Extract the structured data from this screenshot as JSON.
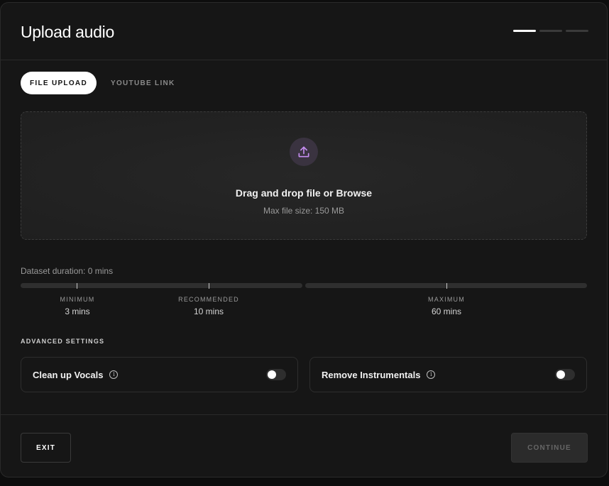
{
  "modal": {
    "title": "Upload audio",
    "steps": {
      "total": 3,
      "current": 1
    }
  },
  "tabs": [
    {
      "label": "FILE UPLOAD",
      "active": true
    },
    {
      "label": "YOUTUBE LINK",
      "active": false
    }
  ],
  "dropzone": {
    "icon": "upload-icon",
    "title": "Drag and drop file or Browse",
    "subtitle": "Max file size: 150 MB"
  },
  "duration": {
    "label": "Dataset duration: 0 mins",
    "current_mins": 0,
    "scale_max_mins": 60,
    "markers": [
      {
        "label": "MINIMUM",
        "value": "3 mins"
      },
      {
        "label": "RECOMMENDED",
        "value": "10 mins"
      },
      {
        "label": "MAXIMUM",
        "value": "60 mins"
      }
    ]
  },
  "advanced": {
    "label": "ADVANCED SETTINGS",
    "settings": [
      {
        "label": "Clean up Vocals",
        "enabled": false,
        "icon": "info-icon"
      },
      {
        "label": "Remove Instrumentals",
        "enabled": false,
        "icon": "info-icon"
      }
    ]
  },
  "footer": {
    "exit_label": "EXIT",
    "continue_label": "CONTINUE",
    "continue_disabled": true
  },
  "colors": {
    "background": "#161616",
    "accent_icon": "#c58df0",
    "icon_circle": "#3a3340",
    "muted_text": "#9a9a9a"
  }
}
